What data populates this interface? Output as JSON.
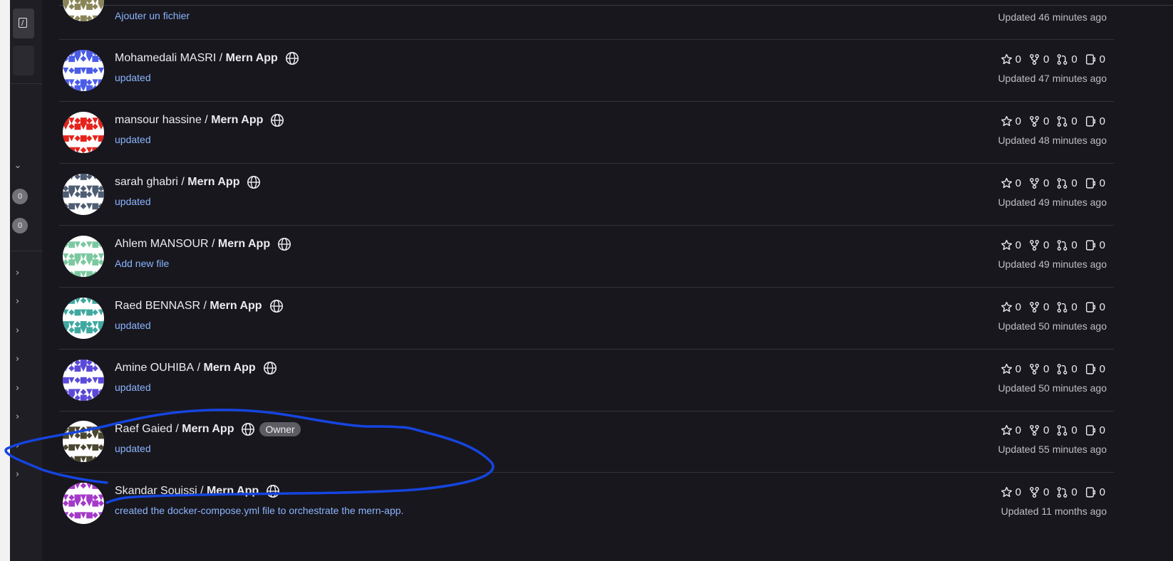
{
  "sidebar": {
    "badges": [
      "0",
      "0"
    ]
  },
  "projects": [
    {
      "owner": "Mohamedali MASRI",
      "separator": " / ",
      "name": "Mern App",
      "desc": "updated",
      "stars": "0",
      "forks": "0",
      "mrs": "0",
      "issues": "0",
      "updated": "Updated 47 minutes ago",
      "color": "#4b5ce8"
    },
    {
      "owner": "mansour hassine",
      "separator": " / ",
      "name": "Mern App",
      "desc": "updated",
      "stars": "0",
      "forks": "0",
      "mrs": "0",
      "issues": "0",
      "updated": "Updated 48 minutes ago",
      "color": "#e5231c"
    },
    {
      "owner": "sarah ghabri",
      "separator": " / ",
      "name": "Mern App",
      "desc": "updated",
      "stars": "0",
      "forks": "0",
      "mrs": "0",
      "issues": "0",
      "updated": "Updated 49 minutes ago",
      "color": "#4e5d72"
    },
    {
      "owner": "Ahlem MANSOUR",
      "separator": " / ",
      "name": "Mern App",
      "desc": "Add new file",
      "stars": "0",
      "forks": "0",
      "mrs": "0",
      "issues": "0",
      "updated": "Updated 49 minutes ago",
      "color": "#7cc8a0"
    },
    {
      "owner": "Raed BENNASR",
      "separator": " / ",
      "name": "Mern App",
      "desc": "updated",
      "stars": "0",
      "forks": "0",
      "mrs": "0",
      "issues": "0",
      "updated": "Updated 50 minutes ago",
      "color": "#3fa9a0"
    },
    {
      "owner": "Amine OUHIBA",
      "separator": " / ",
      "name": "Mern App",
      "desc": "updated",
      "stars": "0",
      "forks": "0",
      "mrs": "0",
      "issues": "0",
      "updated": "Updated 50 minutes ago",
      "color": "#5b4ad9"
    },
    {
      "owner": "Raef Gaied",
      "separator": " / ",
      "name": "Mern App",
      "desc": "updated",
      "badge": "Owner",
      "stars": "0",
      "forks": "0",
      "mrs": "0",
      "issues": "0",
      "updated": "Updated 55 minutes ago",
      "color": "#4a4630"
    },
    {
      "owner": "Skandar Souissi",
      "separator": " / ",
      "name": "Mern App",
      "desc": "created the docker-compose.yml file to orchestrate the mern-app.",
      "stars": "0",
      "forks": "0",
      "mrs": "0",
      "issues": "0",
      "updated": "Updated 11 months ago",
      "color": "#a53ac9"
    }
  ],
  "partial_row": {
    "desc": "Ajouter un fichier",
    "updated": "Updated 46 minutes ago",
    "color": "#8a8558"
  },
  "annotation_color": "#1545e0"
}
